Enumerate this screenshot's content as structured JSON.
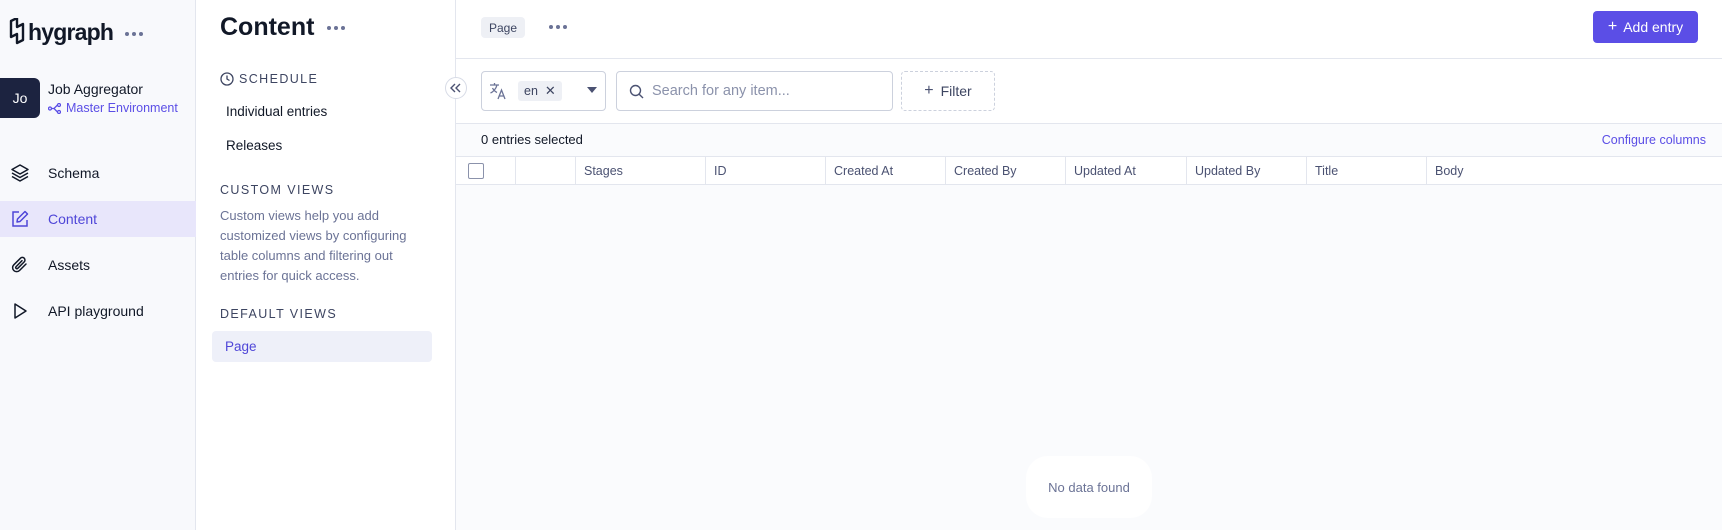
{
  "brand": {
    "name": "hygraph"
  },
  "project": {
    "initials": "Jo",
    "name": "Job Aggregator",
    "environment": "Master Environment"
  },
  "nav": {
    "items": [
      {
        "label": "Schema",
        "icon": "layers-icon"
      },
      {
        "label": "Content",
        "icon": "edit-icon",
        "active": true
      },
      {
        "label": "Assets",
        "icon": "paperclip-icon"
      },
      {
        "label": "API playground",
        "icon": "play-icon"
      }
    ]
  },
  "views_panel": {
    "title": "Content",
    "schedule_heading": "SCHEDULE",
    "schedule_items": [
      "Individual entries",
      "Releases"
    ],
    "custom_heading": "CUSTOM VIEWS",
    "custom_description": "Custom views help you add customized views by configuring table columns and filtering out entries for quick access.",
    "default_heading": "DEFAULT VIEWS",
    "default_items": [
      "Page"
    ]
  },
  "topbar": {
    "tab_label": "Page",
    "add_entry_label": "Add entry"
  },
  "filters": {
    "locale": "en",
    "search_placeholder": "Search for any item...",
    "filter_label": "Filter"
  },
  "table": {
    "selected_text": "0 entries selected",
    "configure_label": "Configure columns",
    "columns": [
      "",
      "Stages",
      "ID",
      "Created At",
      "Created By",
      "Updated At",
      "Updated By",
      "Title",
      "Body"
    ],
    "empty_text": "No data found"
  },
  "colors": {
    "accent": "#5b4ee6",
    "active_bg": "#e8e6fb",
    "dark": "#1c2340"
  }
}
